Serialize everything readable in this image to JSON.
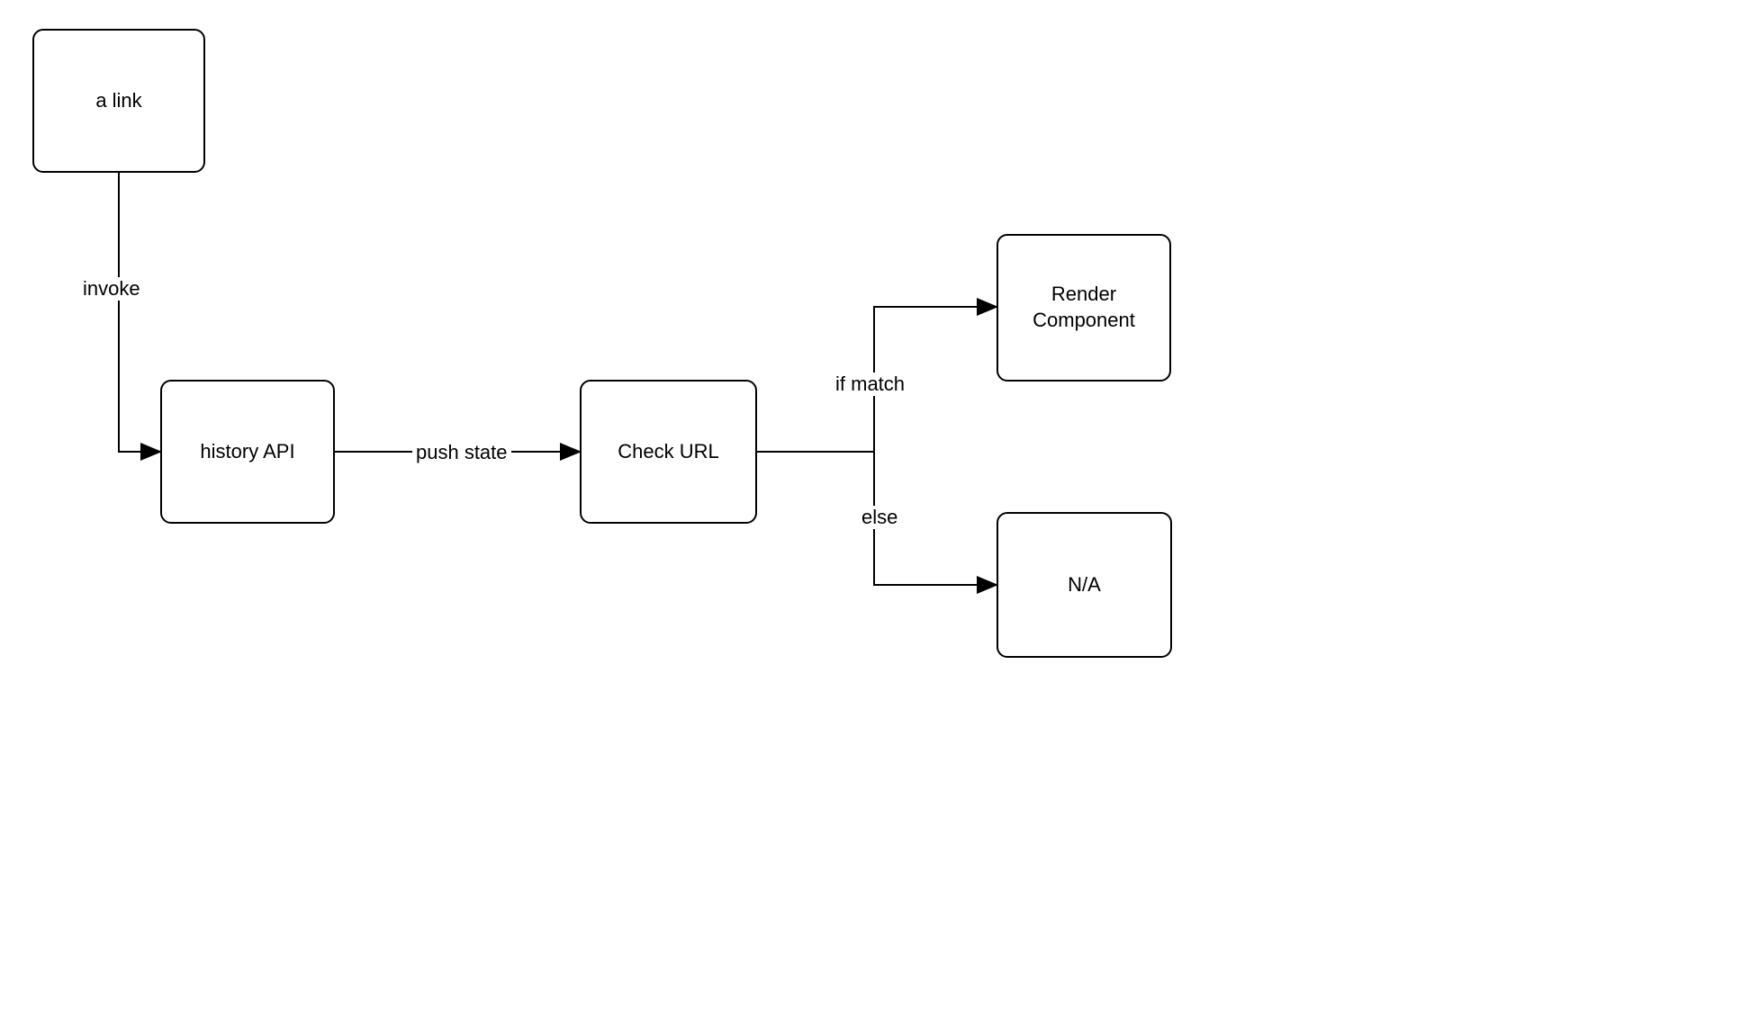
{
  "nodes": {
    "a_link": {
      "label": "a link"
    },
    "history_api": {
      "label": "history API"
    },
    "check_url": {
      "label": "Check URL"
    },
    "render_component": {
      "label": "Render\nComponent"
    },
    "na": {
      "label": "N/A"
    }
  },
  "edges": {
    "invoke": {
      "label": "invoke"
    },
    "push_state": {
      "label": "push state"
    },
    "if_match": {
      "label": "if match"
    },
    "else": {
      "label": "else"
    }
  }
}
